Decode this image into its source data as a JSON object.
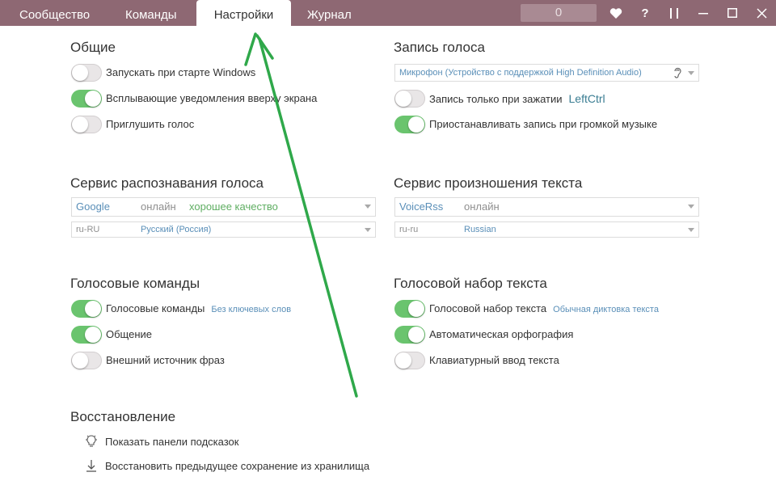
{
  "tabs": [
    {
      "label": "Сообщество",
      "active": false
    },
    {
      "label": "Команды",
      "active": false
    },
    {
      "label": "Настройки",
      "active": true
    },
    {
      "label": "Журнал",
      "active": false
    }
  ],
  "counter": "0",
  "colors": {
    "titlebar": "#8e6873",
    "toggle_on": "#6ac46e",
    "arrow": "#2fa84a",
    "link": "#5a8fb8"
  },
  "general": {
    "title": "Общие",
    "items": [
      {
        "label": "Запускать при старте Windows",
        "on": false
      },
      {
        "label": "Всплывающие уведомления вверху экрана",
        "on": true
      },
      {
        "label": "Приглушить голос",
        "on": false
      }
    ]
  },
  "voice_record": {
    "title": "Запись голоса",
    "microphone": "Микрофон (Устройство с поддержкой High Definition Audio)",
    "hold_label": "Запись только при зажатии",
    "hold_key": "LeftCtrl",
    "hold_on": false,
    "pause_label": "Приостанавливать запись при громкой музыке",
    "pause_on": true
  },
  "recognition": {
    "title": "Сервис распознавания голоса",
    "service": "Google",
    "status": "онлайн",
    "quality": "хорошее качество",
    "lang_code": "ru-RU",
    "lang_name": "Русский (Россия)"
  },
  "tts": {
    "title": "Сервис произношения текста",
    "service": "VoiceRss",
    "status": "онлайн",
    "lang_code": "ru-ru",
    "lang_name": "Russian"
  },
  "voice_commands": {
    "title": "Голосовые команды",
    "items": [
      {
        "label": "Голосовые команды",
        "on": true,
        "link": "Без ключевых слов"
      },
      {
        "label": "Общение",
        "on": true
      },
      {
        "label": "Внешний источник фраз",
        "on": false
      }
    ]
  },
  "dictation": {
    "title": "Голосовой набор текста",
    "items": [
      {
        "label": "Голосовой набор текста",
        "on": true,
        "link": "Обычная диктовка текста"
      },
      {
        "label": "Автоматическая орфография",
        "on": true
      },
      {
        "label": "Клавиатурный ввод текста",
        "on": false
      }
    ]
  },
  "restore": {
    "title": "Восстановление",
    "show_hints": "Показать панели подсказок",
    "restore_backup": "Восстановить предыдущее сохранение из хранилища"
  }
}
